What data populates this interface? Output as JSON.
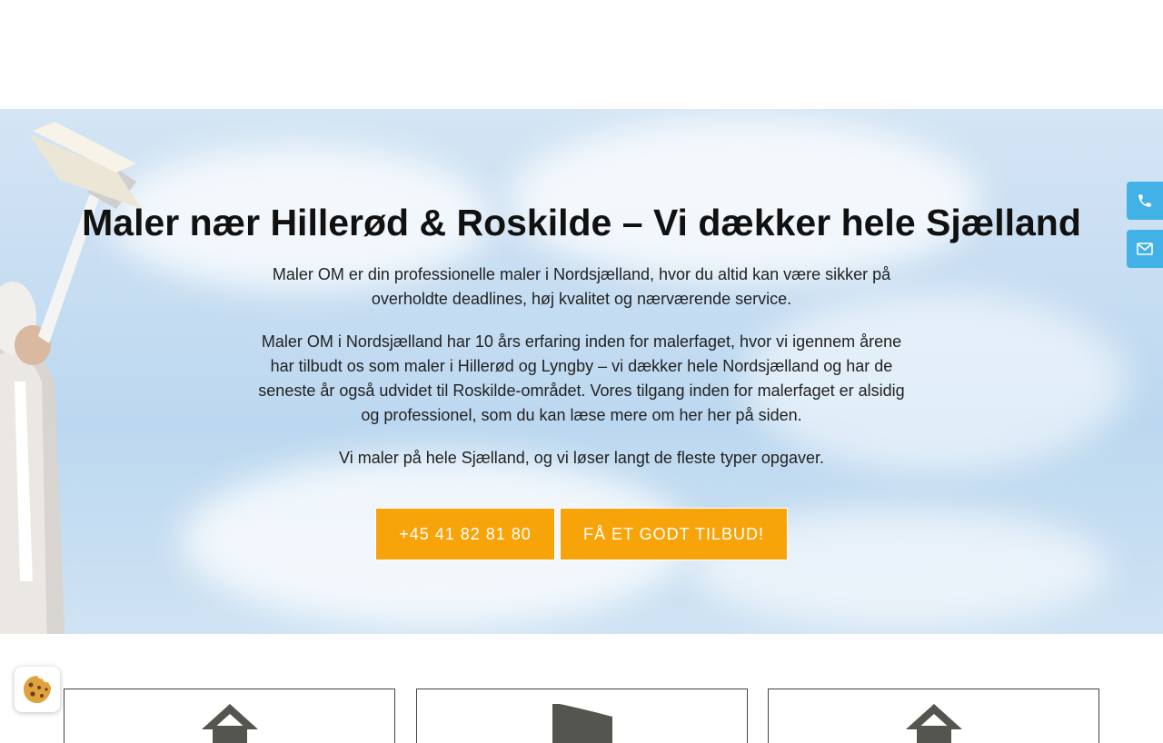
{
  "hero": {
    "title": "Maler nær Hillerød & Roskilde – Vi dækker hele Sjælland",
    "paragraph_1": "Maler OM er din professionelle maler i Nordsjælland, hvor du altid kan være sikker på overholdte deadlines, høj kvalitet og nærværende service.",
    "paragraph_2": "Maler OM i Nordsjælland har 10 års erfaring inden for malerfaget, hvor vi igennem årene har tilbudt os som maler i Hillerød og Lyngby – vi dækker hele Nordsjælland og har de seneste år også udvidet til Roskilde-området. Vores tilgang inden for malerfaget er alsidig og professionel, som du kan læse mere om her her på siden.",
    "paragraph_3": "Vi maler på hele Sjælland, og vi løser langt de fleste typer opgaver.",
    "phone_button": "+45 41 82 81 80",
    "offer_button": "FÅ ET GODT TILBUD!"
  },
  "side_tabs": {
    "phone_icon": "phone-icon",
    "mail_icon": "envelope-icon"
  },
  "cards": [
    {
      "icon": "house-icon"
    },
    {
      "icon": "flag-icon"
    },
    {
      "icon": "house-icon"
    }
  ],
  "cookie": {
    "icon": "cookie-icon"
  },
  "colors": {
    "accent": "#f7a40b",
    "side_tab": "#42b2e6",
    "title_text": "#111111",
    "card_icon": "#555550"
  }
}
